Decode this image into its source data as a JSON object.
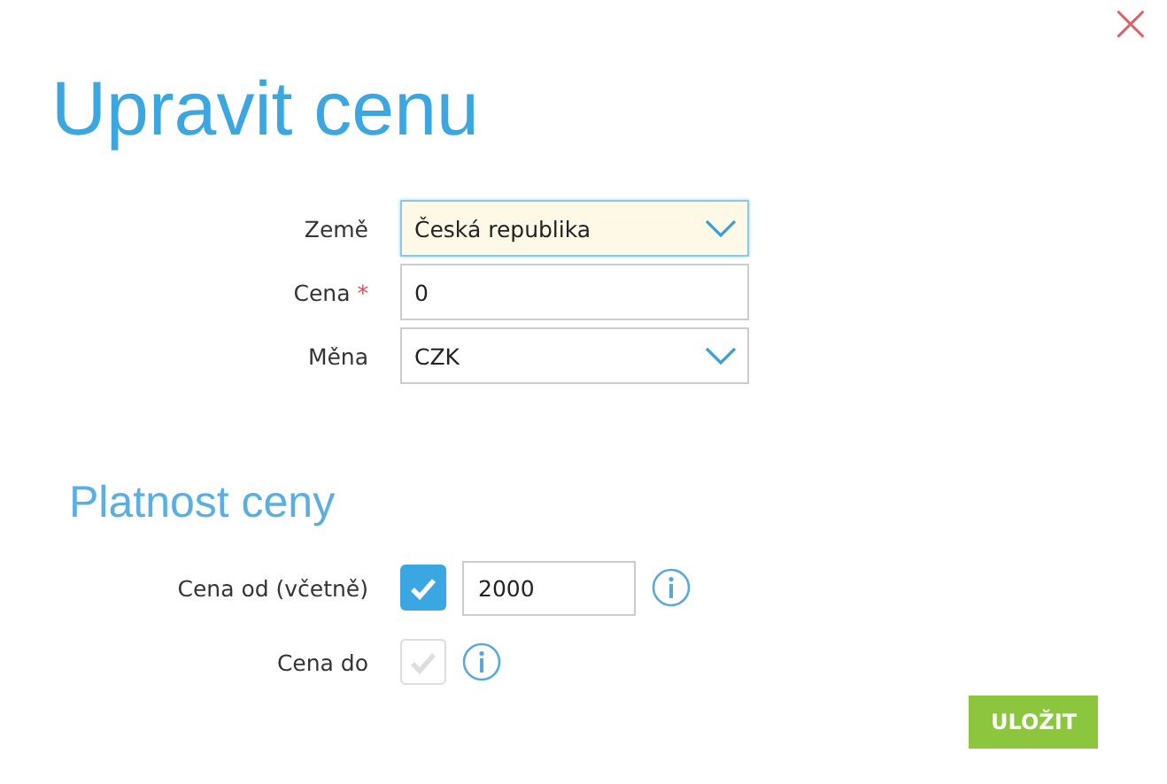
{
  "dialog": {
    "title": "Upravit cenu",
    "close": "×"
  },
  "fields": [
    {
      "label": "Země",
      "kind": "select",
      "value": "Česká republika",
      "focused": true
    },
    {
      "label": "Cena",
      "required_mark": "*",
      "kind": "text",
      "value": "0",
      "focused": false
    },
    {
      "label": "Měna",
      "kind": "select",
      "value": "CZK",
      "focused": false
    }
  ],
  "validity": {
    "title": "Platnost ceny",
    "rows": [
      {
        "label": "Cena od (včetně)",
        "checked": true,
        "value": "2000"
      },
      {
        "label": "Cena do",
        "checked": false
      }
    ]
  },
  "buttons": [
    {
      "label": "ULOŽIT"
    }
  ]
}
